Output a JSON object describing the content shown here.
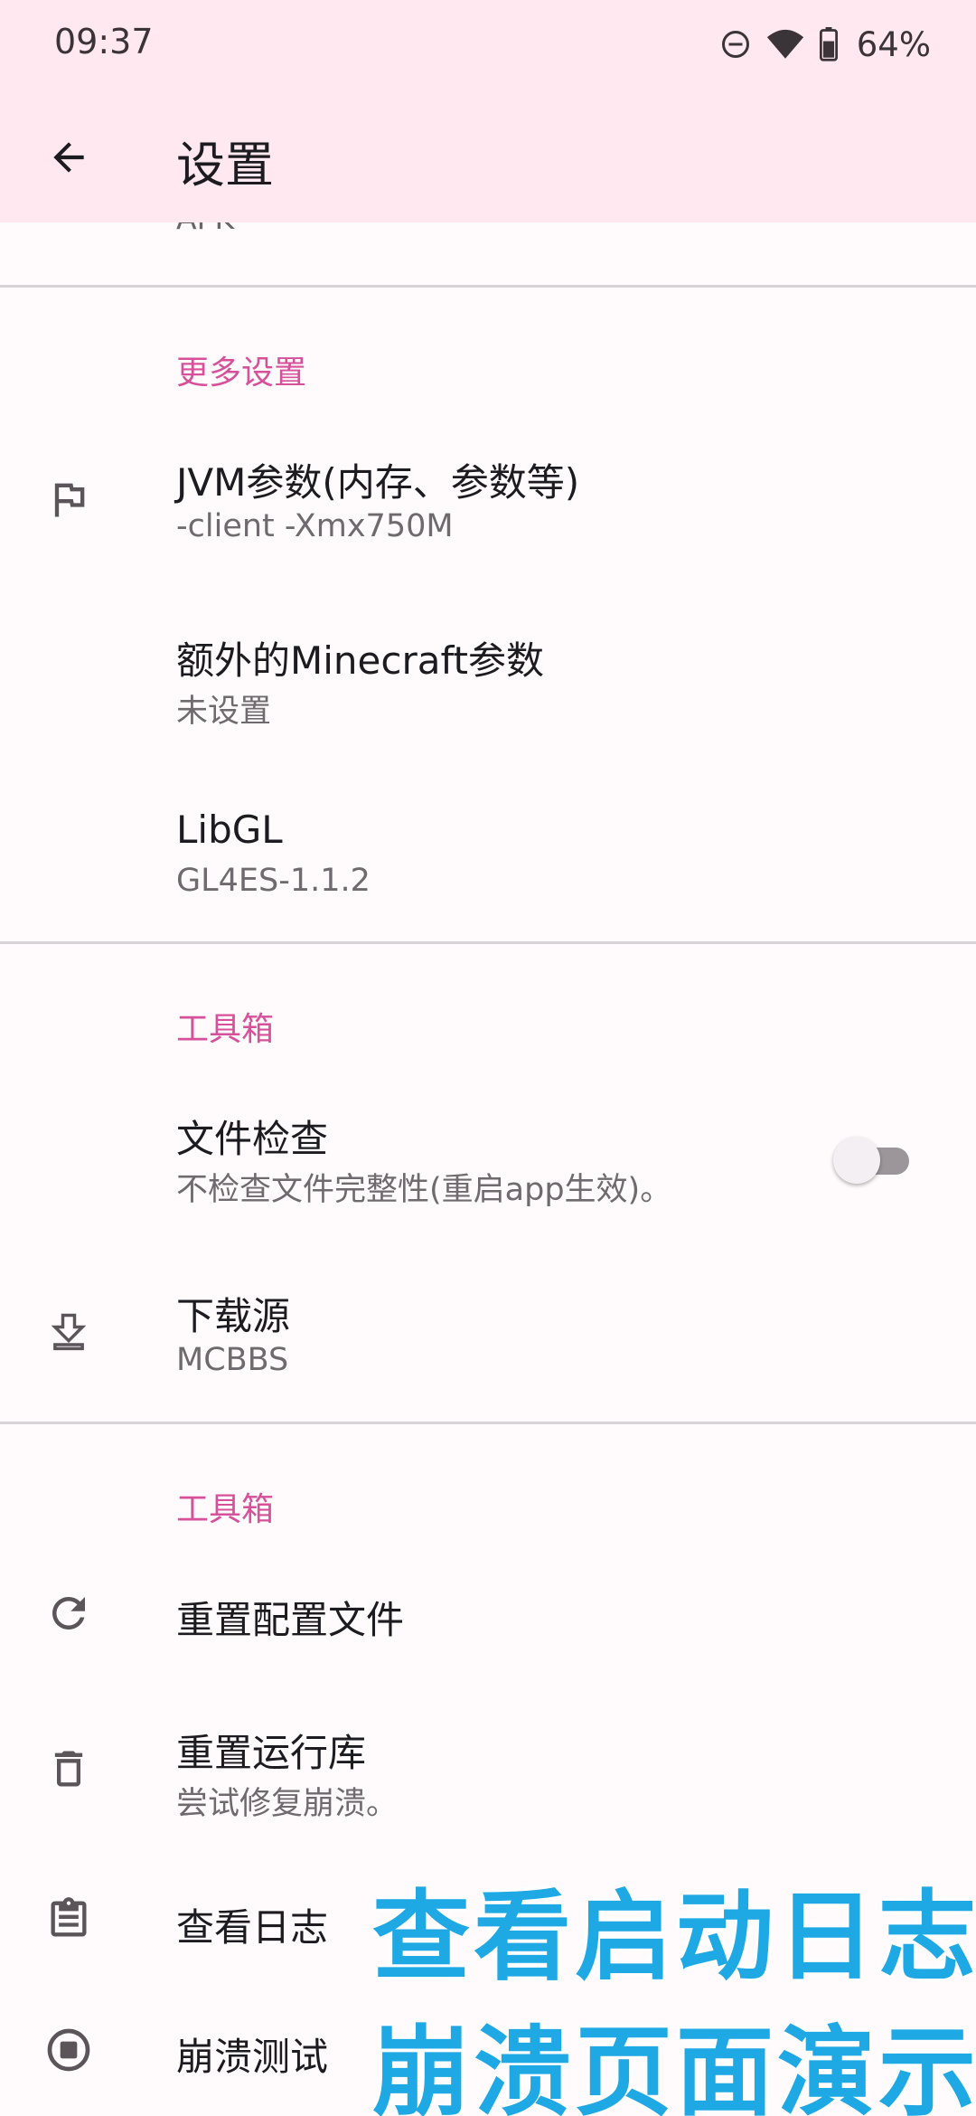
{
  "status_bar": {
    "time": "09:37",
    "battery_percent": "64%",
    "icons": [
      "do-not-disturb-icon",
      "wifi-icon",
      "battery-icon"
    ]
  },
  "app_bar": {
    "title": "设置",
    "back_icon": "arrow-back-icon"
  },
  "partial_item": {
    "subtitle": "APK"
  },
  "sections": {
    "more": {
      "header": "更多设置",
      "items": [
        {
          "title": "JVM参数(内存、参数等)",
          "subtitle": "-client -Xmx750M",
          "icon": "flag-icon"
        },
        {
          "title": "额外的Minecraft参数",
          "subtitle": "未设置"
        },
        {
          "title": "LibGL",
          "subtitle": "GL4ES-1.1.2"
        }
      ]
    },
    "toolbox1": {
      "header": "工具箱",
      "items": [
        {
          "title": "文件检查",
          "subtitle": "不检查文件完整性(重启app生效)。",
          "switch_on": false
        },
        {
          "title": "下载源",
          "subtitle": "MCBBS",
          "icon": "download-icon"
        }
      ]
    },
    "toolbox2": {
      "header": "工具箱",
      "items": [
        {
          "title": "重置配置文件",
          "icon": "refresh-icon"
        },
        {
          "title": "重置运行库",
          "subtitle": "尝试修复崩溃。",
          "icon": "delete-icon"
        },
        {
          "title": "查看日志",
          "icon": "clipboard-icon"
        },
        {
          "title": "崩溃测试",
          "icon": "stop-circle-icon"
        }
      ]
    }
  },
  "overlay": {
    "line1": "查看启动日志",
    "line2": "崩溃页面演示"
  },
  "colors": {
    "accent": "#d6509a",
    "header_bg": "#ffe8ef",
    "overlay_text": "#1ea8e4"
  }
}
